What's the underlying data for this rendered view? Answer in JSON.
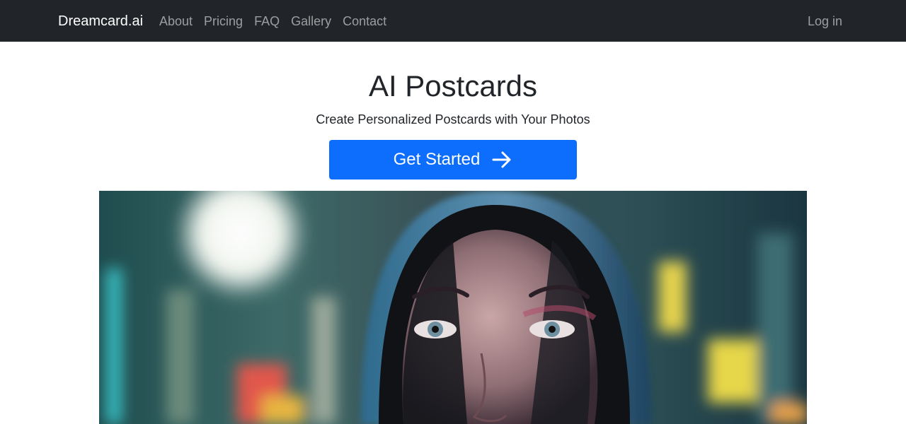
{
  "nav": {
    "brand": "Dreamcard.ai",
    "links": [
      "About",
      "Pricing",
      "FAQ",
      "Gallery",
      "Contact"
    ],
    "login": "Log in"
  },
  "hero": {
    "title": "AI Postcards",
    "subtitle": "Create Personalized Postcards with Your Photos",
    "cta_label": "Get Started",
    "cta_icon": "arrow-right-icon"
  },
  "colors": {
    "navbar_bg": "#212529",
    "primary": "#0d6efd",
    "text": "#212529"
  }
}
